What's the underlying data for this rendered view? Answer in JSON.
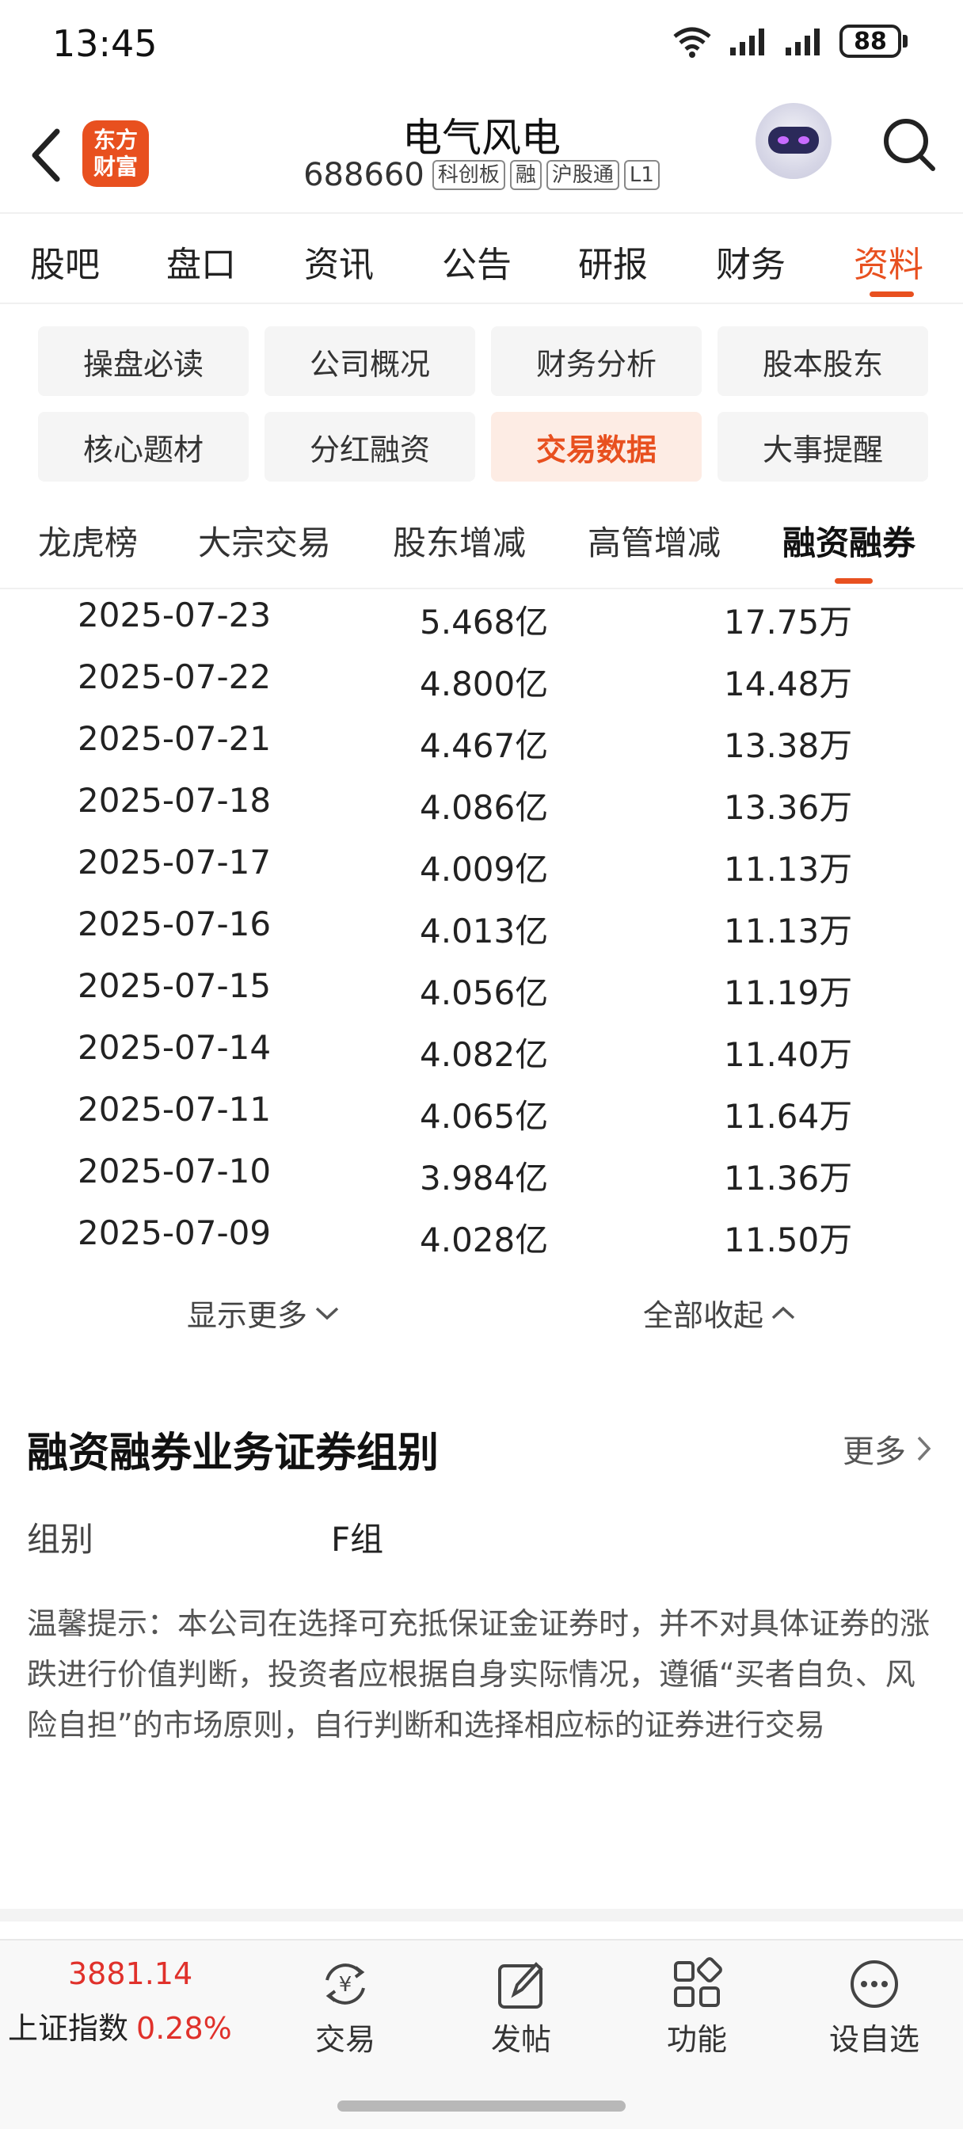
{
  "status_bar": {
    "time": "13:45",
    "battery": "88"
  },
  "header": {
    "logo_line1": "东方",
    "logo_line2": "财富",
    "stock_name": "电气风电",
    "stock_code": "688660",
    "tags": [
      "科创板",
      "融",
      "沪股通",
      "L1"
    ]
  },
  "main_tabs": [
    {
      "label": "股吧",
      "active": false
    },
    {
      "label": "盘口",
      "active": false
    },
    {
      "label": "资讯",
      "active": false
    },
    {
      "label": "公告",
      "active": false
    },
    {
      "label": "研报",
      "active": false
    },
    {
      "label": "财务",
      "active": false
    },
    {
      "label": "资料",
      "active": true
    }
  ],
  "sub_buttons": [
    {
      "label": "操盘必读",
      "active": false
    },
    {
      "label": "公司概况",
      "active": false
    },
    {
      "label": "财务分析",
      "active": false
    },
    {
      "label": "股本股东",
      "active": false
    },
    {
      "label": "核心题材",
      "active": false
    },
    {
      "label": "分红融资",
      "active": false
    },
    {
      "label": "交易数据",
      "active": true
    },
    {
      "label": "大事提醒",
      "active": false
    }
  ],
  "data_tabs": [
    {
      "label": "龙虎榜",
      "active": false
    },
    {
      "label": "大宗交易",
      "active": false
    },
    {
      "label": "股东增减",
      "active": false
    },
    {
      "label": "高管增减",
      "active": false
    },
    {
      "label": "融资融券",
      "active": true
    }
  ],
  "table_rows": [
    {
      "date": "2025-07-23",
      "balance": "5.468亿",
      "volume": "17.75万"
    },
    {
      "date": "2025-07-22",
      "balance": "4.800亿",
      "volume": "14.48万"
    },
    {
      "date": "2025-07-21",
      "balance": "4.467亿",
      "volume": "13.38万"
    },
    {
      "date": "2025-07-18",
      "balance": "4.086亿",
      "volume": "13.36万"
    },
    {
      "date": "2025-07-17",
      "balance": "4.009亿",
      "volume": "11.13万"
    },
    {
      "date": "2025-07-16",
      "balance": "4.013亿",
      "volume": "11.13万"
    },
    {
      "date": "2025-07-15",
      "balance": "4.056亿",
      "volume": "11.19万"
    },
    {
      "date": "2025-07-14",
      "balance": "4.082亿",
      "volume": "11.40万"
    },
    {
      "date": "2025-07-11",
      "balance": "4.065亿",
      "volume": "11.64万"
    },
    {
      "date": "2025-07-10",
      "balance": "3.984亿",
      "volume": "11.36万"
    },
    {
      "date": "2025-07-09",
      "balance": "4.028亿",
      "volume": "11.50万"
    }
  ],
  "controls": {
    "show_more": "显示更多",
    "collapse_all": "全部收起"
  },
  "section": {
    "title": "融资融券业务证券组别",
    "more": "更多",
    "group_label": "组别",
    "group_value": "F组",
    "tip": "温馨提示：本公司在选择可充抵保证金证券时，并不对具体证券的涨跌进行价值判断，投资者应根据自身实际情况，遵循“买者自负、风险自担”的市场原则，自行判断和选择相应标的证券进行交易"
  },
  "bottom_nav": {
    "index_value": "3881.14",
    "index_name": "上证指数",
    "index_change": "0.28%",
    "items": [
      {
        "label": "交易",
        "icon": "trade-icon"
      },
      {
        "label": "发帖",
        "icon": "post-icon"
      },
      {
        "label": "功能",
        "icon": "grid-icon"
      },
      {
        "label": "设自选",
        "icon": "more-dots-icon"
      }
    ]
  },
  "colors": {
    "accent": "#e8501f",
    "up": "#e0312b"
  }
}
